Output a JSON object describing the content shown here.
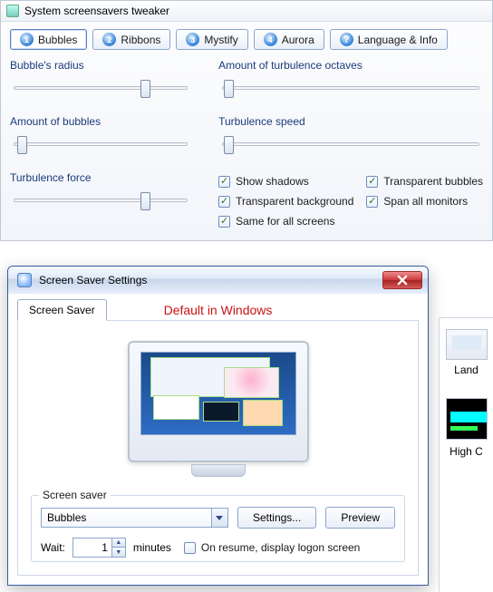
{
  "tweaker": {
    "title": "System screensavers tweaker",
    "tabs": [
      {
        "num": "1",
        "label": "Bubbles"
      },
      {
        "num": "2",
        "label": "Ribbons"
      },
      {
        "num": "3",
        "label": "Mystify"
      },
      {
        "num": "4",
        "label": "Aurora"
      },
      {
        "num": "?",
        "label": "Language & Info"
      }
    ],
    "sliders": {
      "radius": {
        "label": "Bubble's radius",
        "pos": 0.72
      },
      "amount": {
        "label": "Amount of bubbles",
        "pos": 0.04
      },
      "force": {
        "label": "Turbulence force",
        "pos": 0.72
      },
      "octaves": {
        "label": "Amount of turbulence octaves",
        "pos": 0.02
      },
      "speed": {
        "label": "Turbulence speed",
        "pos": 0.02
      }
    },
    "checks": {
      "shadows": "Show shadows",
      "transbub": "Transparent bubbles",
      "transbg": "Transparent background",
      "span": "Span all monitors",
      "same": "Same for all screens"
    }
  },
  "dlg": {
    "title": "Screen Saver Settings",
    "overlay": "Default in Windows",
    "tab": "Screen Saver",
    "group": "Screen saver",
    "combo_value": "Bubbles",
    "settings_btn": "Settings...",
    "preview_btn": "Preview",
    "wait_label": "Wait:",
    "wait_value": "1",
    "minutes": "minutes",
    "onresume": "On resume, display logon screen"
  },
  "right": {
    "cap1": "Land",
    "cap2": "High C"
  }
}
